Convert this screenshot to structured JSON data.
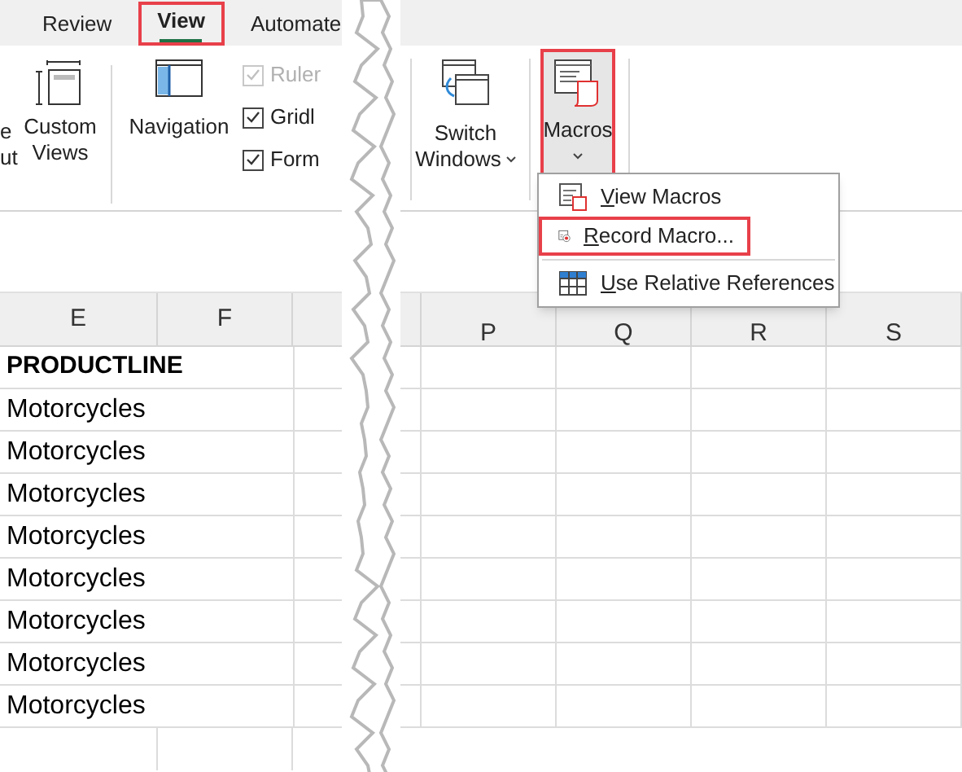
{
  "tabs": [
    {
      "label": "Review",
      "selected": false
    },
    {
      "label": "View",
      "selected": true,
      "highlighted": true
    },
    {
      "label": "Automate",
      "selected": false
    }
  ],
  "ribbon_left": {
    "cut_button": {
      "lines": [
        "e",
        "ut"
      ]
    },
    "custom_views": {
      "lines": [
        "Custom",
        "Views"
      ]
    },
    "navigation": {
      "label": "Navigation"
    },
    "checkboxes": [
      {
        "label": "Ruler",
        "checked": true,
        "disabled": true
      },
      {
        "label": "Gridl",
        "checked": true,
        "disabled": false
      },
      {
        "label": "Form",
        "checked": true,
        "disabled": false
      }
    ]
  },
  "ribbon_right": {
    "switch_windows": {
      "lines": [
        "Switch",
        "Windows"
      ]
    },
    "macros": {
      "label": "Macros",
      "highlighted": true
    }
  },
  "macros_menu": [
    {
      "label": "View Macros",
      "kind": "view",
      "highlighted": false
    },
    {
      "label": "Record Macro...",
      "kind": "record",
      "highlighted": true
    },
    {
      "label": "Use Relative References",
      "kind": "relative",
      "highlighted": false
    }
  ],
  "sheet_left": {
    "columns": [
      "E",
      "F"
    ],
    "rows": [
      {
        "value": "PRODUCTLINE",
        "kind": "header"
      },
      {
        "value": "Motorcycles",
        "kind": "value"
      },
      {
        "value": "Motorcycles",
        "kind": "value"
      },
      {
        "value": "Motorcycles",
        "kind": "value"
      },
      {
        "value": "Motorcycles",
        "kind": "value"
      },
      {
        "value": "Motorcycles",
        "kind": "value"
      },
      {
        "value": "Motorcycles",
        "kind": "value"
      },
      {
        "value": "Motorcycles",
        "kind": "value"
      },
      {
        "value": "Motorcycles",
        "kind": "value"
      }
    ]
  },
  "sheet_right": {
    "columns": [
      "P",
      "Q",
      "R",
      "S"
    ]
  }
}
